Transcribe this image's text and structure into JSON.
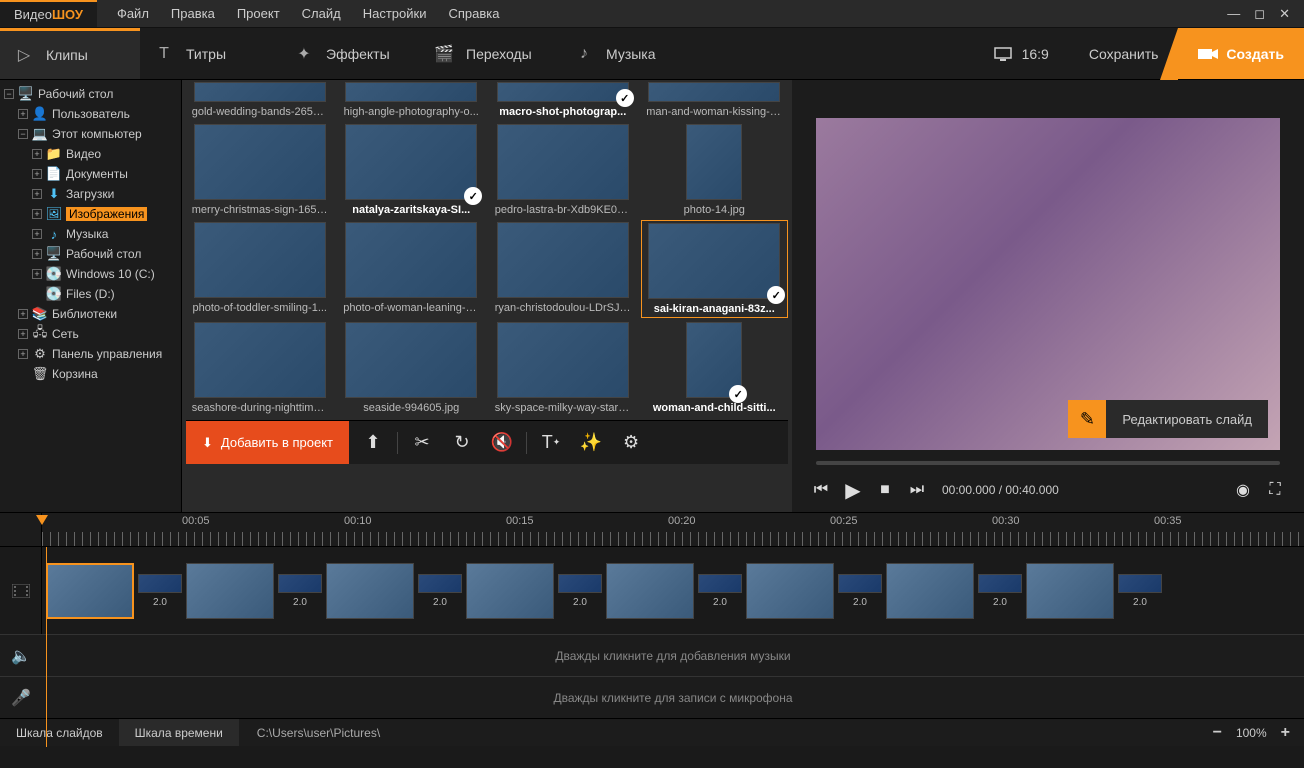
{
  "app": {
    "logo1": "Видео",
    "logo2": "ШОУ"
  },
  "menu": {
    "file": "Файл",
    "edit": "Правка",
    "project": "Проект",
    "slide": "Слайд",
    "settings": "Настройки",
    "help": "Справка"
  },
  "tabs": {
    "clips": "Клипы",
    "titles": "Титры",
    "effects": "Эффекты",
    "transitions": "Переходы",
    "music": "Музыка"
  },
  "toolbar": {
    "aspect": "16:9",
    "save": "Сохранить",
    "create": "Создать"
  },
  "tree": {
    "desktop": "Рабочий стол",
    "user": "Пользователь",
    "thispc": "Этот компьютер",
    "videos": "Видео",
    "documents": "Документы",
    "downloads": "Загрузки",
    "images": "Изображения",
    "music": "Музыка",
    "desk2": "Рабочий стол",
    "win10": "Windows 10 (C:)",
    "filesd": "Files (D:)",
    "libraries": "Библиотеки",
    "network": "Сеть",
    "control": "Панель управления",
    "trash": "Корзина"
  },
  "thumbs": [
    {
      "label": "gold-wedding-bands-2657...",
      "bold": false,
      "check": false,
      "partial": true
    },
    {
      "label": "high-angle-photography-o...",
      "bold": false,
      "check": false,
      "partial": true
    },
    {
      "label": "macro-shot-photograp...",
      "bold": true,
      "check": true,
      "partial": true
    },
    {
      "label": "man-and-woman-kissing-2...",
      "bold": false,
      "check": false,
      "partial": true
    },
    {
      "label": "merry-christmas-sign-1656...",
      "bold": false,
      "check": false,
      "partial": false
    },
    {
      "label": "natalya-zaritskaya-SI...",
      "bold": true,
      "check": true,
      "partial": false
    },
    {
      "label": "pedro-lastra-br-Xdb9KE0Q...",
      "bold": false,
      "check": false,
      "partial": false
    },
    {
      "label": "photo-14.jpg",
      "bold": false,
      "check": false,
      "partial": false,
      "portrait": true
    },
    {
      "label": "photo-of-toddler-smiling-1...",
      "bold": false,
      "check": false,
      "partial": false
    },
    {
      "label": "photo-of-woman-leaning-o...",
      "bold": false,
      "check": false,
      "partial": false
    },
    {
      "label": "ryan-christodoulou-LDrSJ3...",
      "bold": false,
      "check": false,
      "partial": false
    },
    {
      "label": "sai-kiran-anagani-83z...",
      "bold": true,
      "check": true,
      "partial": false,
      "selected": true
    },
    {
      "label": "seashore-during-nighttime...",
      "bold": false,
      "check": false,
      "partial": false
    },
    {
      "label": "seaside-994605.jpg",
      "bold": false,
      "check": false,
      "partial": false
    },
    {
      "label": "sky-space-milky-way-stars-...",
      "bold": false,
      "check": false,
      "partial": false
    },
    {
      "label": "woman-and-child-sitti...",
      "bold": true,
      "check": true,
      "partial": false,
      "portrait": true
    }
  ],
  "thumb_toolbar": {
    "add": "Добавить в проект"
  },
  "preview": {
    "edit_slide": "Редактировать слайд"
  },
  "playback": {
    "current": "00:00.000",
    "total": "00:40.000",
    "sep": " / "
  },
  "ruler": [
    "00:05",
    "00:10",
    "00:15",
    "00:20",
    "00:25",
    "00:30",
    "00:35"
  ],
  "timeline": {
    "trans_dur": "2.0",
    "clip_count": 8
  },
  "audio": {
    "music_hint": "Дважды кликните для добавления музыки",
    "mic_hint": "Дважды кликните для записи с микрофона"
  },
  "status": {
    "slides_scale": "Шкала слайдов",
    "time_scale": "Шкала времени",
    "path": "C:\\Users\\user\\Pictures\\",
    "zoom": "100%"
  }
}
